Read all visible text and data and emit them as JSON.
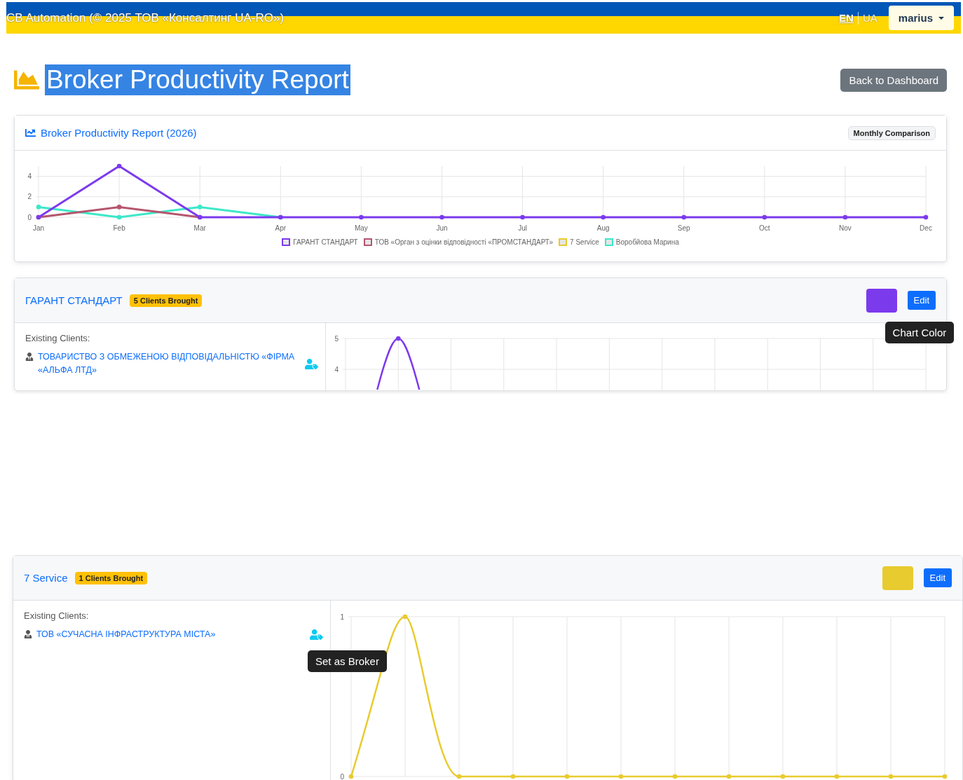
{
  "navbar": {
    "brand": "CB Automation (© 2025 ТОВ «Консалтинг UA-RO»)",
    "languages": [
      {
        "label": "EN",
        "selected": true
      },
      {
        "label": "UA",
        "selected": false
      }
    ],
    "user": "marius"
  },
  "page": {
    "title": "Broker Productivity Report",
    "back_button": "Back to Dashboard"
  },
  "summary": {
    "title": "Broker Productivity Report (2026)",
    "badge": "Monthly Comparison",
    "chart_data": {
      "type": "line",
      "grid": true,
      "categories": [
        "Jan",
        "Feb",
        "Mar",
        "Apr",
        "May",
        "Jun",
        "Jul",
        "Aug",
        "Sep",
        "Oct",
        "Nov",
        "Dec"
      ],
      "ylim": [
        0,
        5
      ],
      "yticks": [
        0,
        2,
        4
      ],
      "series": [
        {
          "name": "ГАРАНТ СТАНДАРТ",
          "color": "#7c3aed",
          "marker": "o",
          "values": [
            0,
            5,
            0,
            0,
            0,
            0,
            0,
            0,
            0,
            0,
            0,
            0
          ]
        },
        {
          "name": "ТОВ «Орган з оцінки відповідності «ПРОМСТАНДАРТ»",
          "color": "#b5566e",
          "marker": "o",
          "values": [
            0,
            1,
            0,
            null,
            null,
            null,
            null,
            null,
            null,
            null,
            null,
            null
          ]
        },
        {
          "name": "7 Service",
          "color": "#e8cb2f",
          "marker": "o",
          "values": [
            null,
            null,
            null,
            null,
            null,
            null,
            null,
            null,
            null,
            null,
            null,
            null
          ]
        },
        {
          "name": "Воробйова Марина",
          "color": "#3de8c8",
          "marker": "o",
          "values": [
            1,
            0,
            1,
            0,
            null,
            null,
            null,
            null,
            null,
            null,
            null,
            null
          ]
        }
      ]
    }
  },
  "brokers": [
    {
      "name": "ГАРАНТ СТАНДАРТ",
      "badge": "5 Clients Brought",
      "color": "#7c3aed",
      "edit": "Edit",
      "color_tooltip": "Chart Color",
      "clients_heading": "Existing Clients:",
      "clients": [
        {
          "name": "ТОВАРИСТВО З ОБМЕЖЕНОЮ ВІДПОВІДАЛЬНІСТЮ «ФІРМА «АЛЬФА ЛТД»"
        }
      ],
      "chart_labels": [
        "5",
        "4"
      ]
    },
    {
      "name": "7 Service",
      "badge": "1 Clients Brought",
      "color": "#e8cb2f",
      "edit": "Edit",
      "clients_heading": "Existing Clients:",
      "clients": [
        {
          "name": "ТОВ «СУЧАСНА ІНФРАСТРУКТУРА МІСТА»",
          "tooltip": "Set as Broker"
        }
      ],
      "chart_labels": [
        "1",
        "0"
      ]
    }
  ]
}
